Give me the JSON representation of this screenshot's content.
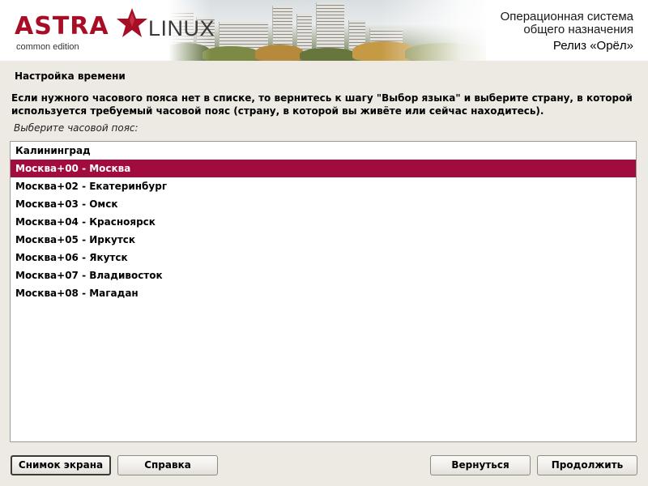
{
  "banner": {
    "logo_astra": "ASTRA",
    "logo_linux": "LINUX",
    "logo_edition": "common edition",
    "os_title_line1": "Операционная система",
    "os_title_line2": "общего назначения",
    "release": "Релиз «Орёл»"
  },
  "colors": {
    "brand_red": "#a70d24",
    "selection": "#a20b3e"
  },
  "section_title": "Настройка времени",
  "description": "Если нужного часового пояса нет в списке, то вернитесь к шагу \"Выбор языка\" и выберите страну, в которой используется требуемый часовой пояс (страну, в которой вы живёте или сейчас находитесь).",
  "prompt": "Выберите часовой пояс:",
  "timezones": {
    "selected": "Москва+00 - Москва",
    "items": [
      "Калининград",
      "Москва+00 - Москва",
      "Москва+02 - Екатеринбург",
      "Москва+03 - Омск",
      "Москва+04 - Красноярск",
      "Москва+05 - Иркутск",
      "Москва+06 - Якутск",
      "Москва+07 - Владивосток",
      "Москва+08 - Магадан"
    ]
  },
  "buttons": {
    "screenshot": "Снимок экрана",
    "help": "Справка",
    "back": "Вернуться",
    "continue": "Продолжить"
  }
}
